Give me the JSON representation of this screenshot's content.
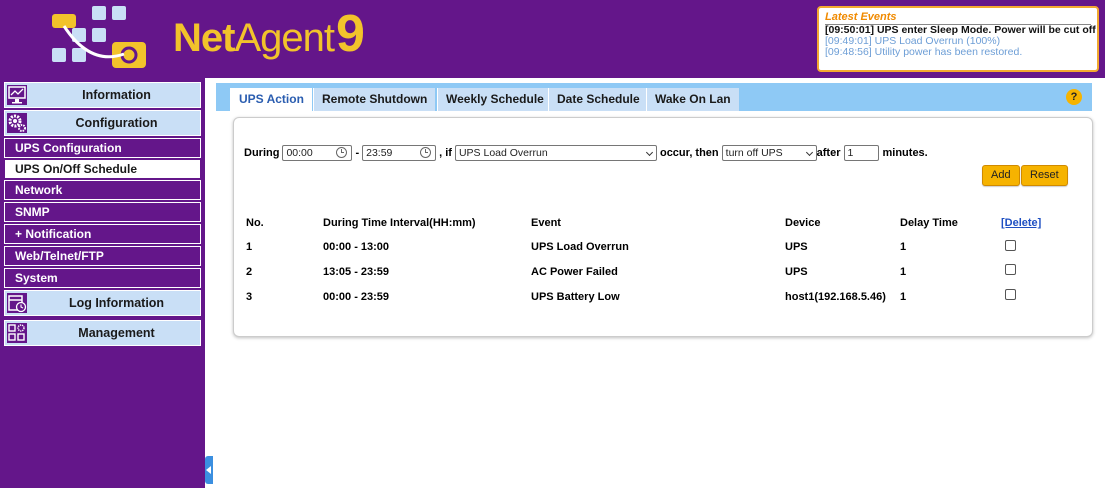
{
  "app": {
    "brand_net": "Net",
    "brand_agent": "Agent",
    "brand_nine": "9"
  },
  "events": {
    "title": "Latest Events",
    "items": [
      "[09:50:01] UPS enter Sleep Mode. Power will be cut off",
      "[09:49:01] UPS Load Overrun (100%)",
      "[09:48:56] Utility power has been restored."
    ]
  },
  "sidebar": {
    "information": "Information",
    "configuration": "Configuration",
    "items": [
      "UPS Configuration",
      "UPS On/Off Schedule",
      "Network",
      "SNMP",
      "+ Notification",
      "Web/Telnet/FTP",
      "System"
    ],
    "log_information": "Log Information",
    "management": "Management"
  },
  "tabs": [
    "UPS Action",
    "Remote Shutdown",
    "Weekly Schedule",
    "Date Schedule",
    "Wake On Lan"
  ],
  "help_label": "?",
  "form": {
    "during_label": "During",
    "from_time": "00:00",
    "dash": "-",
    "to_time": "23:59",
    "if_label": ", if",
    "event_value": "UPS Load Overrun",
    "occur_label": "occur, then",
    "action_value": "turn off UPS",
    "after_label": "after",
    "minutes_value": "1",
    "minutes_label": "minutes.",
    "add_label": "Add",
    "reset_label": "Reset"
  },
  "table": {
    "headers": {
      "no": "No.",
      "interval": "During Time Interval(HH:mm)",
      "event": "Event",
      "device": "Device",
      "delay": "Delay Time",
      "delete": "[Delete]"
    },
    "rows": [
      {
        "no": "1",
        "interval": "00:00 - 13:00",
        "event": "UPS Load Overrun",
        "device": "UPS",
        "delay": "1"
      },
      {
        "no": "2",
        "interval": "13:05 - 23:59",
        "event": "AC Power Failed",
        "device": "UPS",
        "delay": "1"
      },
      {
        "no": "3",
        "interval": "00:00 - 23:59",
        "event": "UPS Battery Low",
        "device": "host1(192.168.5.46)",
        "delay": "1"
      }
    ]
  },
  "colors": {
    "brand_purple": "#64168a",
    "accent_yellow": "#f2c32b",
    "tab_blue": "#8ec9f5",
    "button_orange": "#f6b300"
  }
}
